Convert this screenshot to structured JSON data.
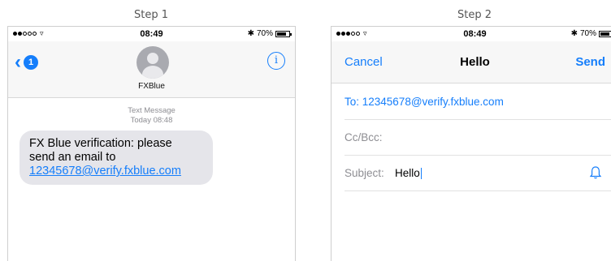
{
  "steps": {
    "step1": "Step 1",
    "step2": "Step 2"
  },
  "phone1": {
    "status": {
      "time": "08:49",
      "battery": "70%"
    },
    "header": {
      "back_badge": "1",
      "contact_name": "FXBlue",
      "info_icon": "info-icon"
    },
    "thread": {
      "meta_line1": "Text Message",
      "meta_line2": "Today 08:48"
    },
    "message": {
      "text_line1": "FX Blue verification: please",
      "text_line2": "send an email to",
      "link": "12345678@verify.fxblue.com"
    }
  },
  "phone2": {
    "status": {
      "time": "08:49",
      "battery": "70%"
    },
    "navbar": {
      "cancel": "Cancel",
      "title": "Hello",
      "send": "Send"
    },
    "fields": {
      "to": "To: 12345678@verify.fxblue.com",
      "ccbcc_label": "Cc/Bcc:",
      "subject_label": "Subject:",
      "subject_value": "Hello"
    }
  },
  "colors": {
    "accent": "#157efb",
    "bubble": "#e5e5ea",
    "secondary_text": "#8e8e93"
  }
}
